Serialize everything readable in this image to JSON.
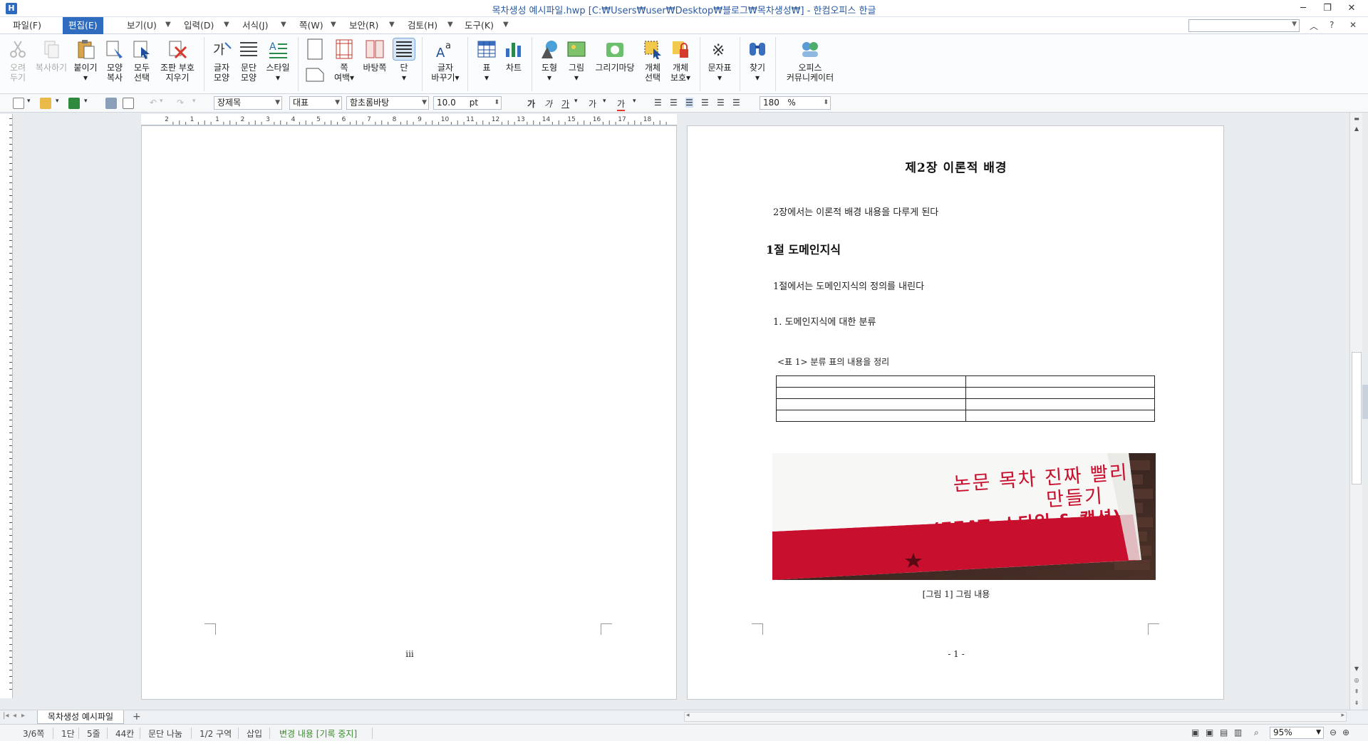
{
  "window": {
    "title": "목차생성 예시파일.hwp [C:₩Users₩user₩Desktop₩블로그₩목차생성₩] - 한컴오피스 한글",
    "app_icon": "H"
  },
  "menu": {
    "items": [
      "파일(F)",
      "편집(E)",
      "보기(U)",
      "입력(D)",
      "서식(J)",
      "쪽(W)",
      "보안(R)",
      "검토(H)",
      "도구(K)"
    ],
    "active": "편집(E)"
  },
  "ribbon": {
    "buttons": [
      {
        "label1": "오려",
        "label2": "두기",
        "icon": "scissors-icon",
        "disabled": true
      },
      {
        "label1": "복사하기",
        "label2": "",
        "icon": "copy-icon",
        "disabled": true
      },
      {
        "label1": "붙이기",
        "label2": "▾",
        "icon": "paste-icon"
      },
      {
        "label1": "모양",
        "label2": "복사",
        "icon": "format-painter-icon"
      },
      {
        "label1": "모두",
        "label2": "선택",
        "icon": "select-all-icon"
      },
      {
        "label1": "조판 부호",
        "label2": "지우기",
        "icon": "clear-codes-icon"
      },
      {
        "label1": "글자",
        "label2": "모양",
        "icon": "char-shape-icon"
      },
      {
        "label1": "문단",
        "label2": "모양",
        "icon": "para-shape-icon"
      },
      {
        "label1": "스타일",
        "label2": "▾",
        "icon": "style-icon"
      },
      {
        "label1": "쪽",
        "label2": "여백▾",
        "icon": "page-margin-icon"
      },
      {
        "label1": "바탕쪽",
        "label2": "",
        "icon": "master-page-icon"
      },
      {
        "label1": "단",
        "label2": "▾",
        "icon": "columns-icon"
      },
      {
        "label1": "글자",
        "label2": "바꾸기▾",
        "icon": "change-char-icon"
      },
      {
        "label1": "표",
        "label2": "▾",
        "icon": "table-icon"
      },
      {
        "label1": "차트",
        "label2": "",
        "icon": "chart-icon"
      },
      {
        "label1": "도형",
        "label2": "▾",
        "icon": "shape-icon"
      },
      {
        "label1": "그림",
        "label2": "▾",
        "icon": "picture-icon"
      },
      {
        "label1": "그리기마당",
        "label2": "",
        "icon": "clipart-icon"
      },
      {
        "label1": "개체",
        "label2": "선택",
        "icon": "object-select-icon"
      },
      {
        "label1": "개체",
        "label2": "보호▾",
        "icon": "object-protect-icon"
      },
      {
        "label1": "문자표",
        "label2": "▾",
        "icon": "symbol-icon"
      },
      {
        "label1": "찾기",
        "label2": "▾",
        "icon": "find-icon"
      },
      {
        "label1": "오피스",
        "label2": "커뮤니케이터",
        "icon": "communicator-icon"
      }
    ]
  },
  "toolbar": {
    "style": "장제목",
    "language": "대표",
    "font": "함초롬바탕",
    "font_size": "10.0",
    "size_unit": "pt",
    "line_spacing": "180",
    "line_spacing_unit": "%"
  },
  "ruler": {
    "marks": [
      "2",
      "1",
      "1",
      "2",
      "3",
      "4",
      "5",
      "6",
      "7",
      "8",
      "9",
      "10",
      "11",
      "12",
      "13",
      "14",
      "15",
      "16",
      "17",
      "18"
    ]
  },
  "left_page": {
    "page_number": "iii"
  },
  "right_page": {
    "chapter_title": "제2장  이론적  배경",
    "chapter_intro": "2장에서는 이론적 배경 내용을 다루게 된다",
    "section_title": "1절  도메인지식",
    "section_intro": "1절에서는 도메인지식의 정의를 내린다",
    "item_heading": "1. 도메인지식에 대한 분류",
    "table_caption": "<표 1> 분류 표의 내용을 정리",
    "table_rows": 4,
    "table_cols": 2,
    "banner": {
      "line1": "논문 목차 진짜 빨리",
      "line2": "만들기",
      "line3": "(FEAT. 스타일 & 캡션)"
    },
    "figure_caption": "[그림 1] 그림 내용",
    "page_number": "- 1 -"
  },
  "tabs": {
    "doc_name": "목차생성 예시파일",
    "add": "+"
  },
  "status": {
    "page": "3/6쪽",
    "column": "1단",
    "line": "5줄",
    "col_pos": "44칸",
    "break": "문단 나눔",
    "section": "1/2 구역",
    "mode": "삽입",
    "track": "변경 내용 [기록 중지]",
    "zoom": "95%"
  },
  "colors": {
    "accent": "#2f6cc0",
    "banner_red": "#c8102e",
    "status_green": "#3a8c2c"
  }
}
